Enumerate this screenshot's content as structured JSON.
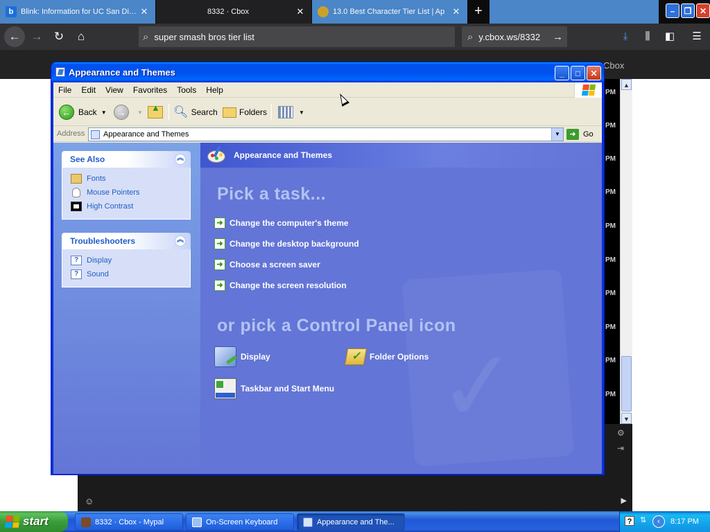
{
  "browser": {
    "tabs": [
      {
        "label": "Blink: Information for UC San Diego",
        "favicon_letter": "b",
        "favicon_color": "#1e6ed8"
      },
      {
        "label": "8332 · Cbox"
      },
      {
        "label": "13.0 Best Character Tier List | Ap",
        "favicon_color": "#caa22a"
      }
    ],
    "new_tab_glyph": "+",
    "url": "super smash bros tier list",
    "search": "y.cbox.ws/8332"
  },
  "webpage": {
    "header_label": "Cbox",
    "time_labels": [
      "PM",
      "PM",
      "PM",
      "PM",
      "PM",
      "PM",
      "PM",
      "PM",
      "PM",
      "PM"
    ]
  },
  "window": {
    "title": "Appearance and Themes",
    "menu": [
      "File",
      "Edit",
      "View",
      "Favorites",
      "Tools",
      "Help"
    ],
    "toolbar": {
      "back": "Back",
      "search": "Search",
      "folders": "Folders"
    },
    "address": {
      "label": "Address",
      "value": "Appearance and Themes",
      "go": "Go"
    },
    "see_also": {
      "title": "See Also",
      "items": [
        "Fonts",
        "Mouse Pointers",
        "High Contrast"
      ]
    },
    "troubleshooters": {
      "title": "Troubleshooters",
      "items": [
        "Display",
        "Sound"
      ]
    },
    "category_header": "Appearance and Themes",
    "pick_task": "Pick a task...",
    "tasks": [
      "Change the computer's theme",
      "Change the desktop background",
      "Choose a screen saver",
      "Change the screen resolution"
    ],
    "pick_icon": "or pick a Control Panel icon",
    "icons": [
      "Display",
      "Folder Options",
      "Taskbar and Start Menu"
    ]
  },
  "taskbar": {
    "start": "start",
    "buttons": [
      "8332 · Cbox - Mypal",
      "On-Screen Keyboard",
      "Appearance and The..."
    ],
    "tray_help": "?",
    "clock": "8:17 PM"
  },
  "colors": {
    "xp_blue": "#0831d9",
    "task_pane": "#6375d6",
    "link_blue": "#215dc6",
    "start_green": "#3a9d3a"
  }
}
